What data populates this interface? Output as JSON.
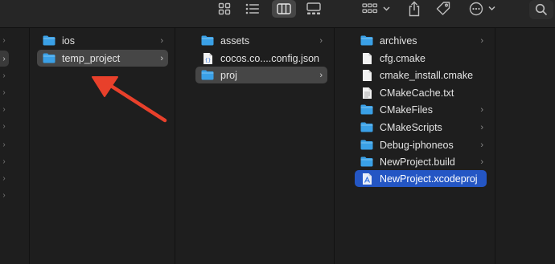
{
  "toolbar": {
    "icons": [
      "grid-view-icon",
      "list-view-icon",
      "column-view-icon",
      "gallery-view-icon",
      "group-by-icon",
      "share-icon",
      "tag-icon",
      "more-actions-icon",
      "search-icon"
    ]
  },
  "columns": {
    "col1": {
      "items": [
        {
          "label": "ios",
          "type": "folder",
          "has_children": true
        },
        {
          "label": "temp_project",
          "type": "folder",
          "has_children": true,
          "selected": true
        }
      ]
    },
    "col2": {
      "items": [
        {
          "label": "assets",
          "type": "folder",
          "has_children": true
        },
        {
          "label": "cocos.co....config.json",
          "type": "json-file",
          "has_children": false
        },
        {
          "label": "proj",
          "type": "folder",
          "has_children": true,
          "selected": true
        }
      ]
    },
    "col3": {
      "items": [
        {
          "label": "archives",
          "type": "folder",
          "has_children": true
        },
        {
          "label": "cfg.cmake",
          "type": "file",
          "has_children": false
        },
        {
          "label": "cmake_install.cmake",
          "type": "file",
          "has_children": false
        },
        {
          "label": "CMakeCache.txt",
          "type": "file",
          "has_children": false
        },
        {
          "label": "CMakeFiles",
          "type": "folder",
          "has_children": true
        },
        {
          "label": "CMakeScripts",
          "type": "folder",
          "has_children": true
        },
        {
          "label": "Debug-iphoneos",
          "type": "folder",
          "has_children": true
        },
        {
          "label": "NewProject.build",
          "type": "folder",
          "has_children": true
        },
        {
          "label": "NewProject.xcodeproj",
          "type": "xcodeproj",
          "has_children": false,
          "selected": true
        }
      ]
    }
  },
  "colors": {
    "folder": "#3aa0e6",
    "selection_active": "#2456c4",
    "selection_inactive": "#464646",
    "arrow_annotation": "#e8402b"
  }
}
